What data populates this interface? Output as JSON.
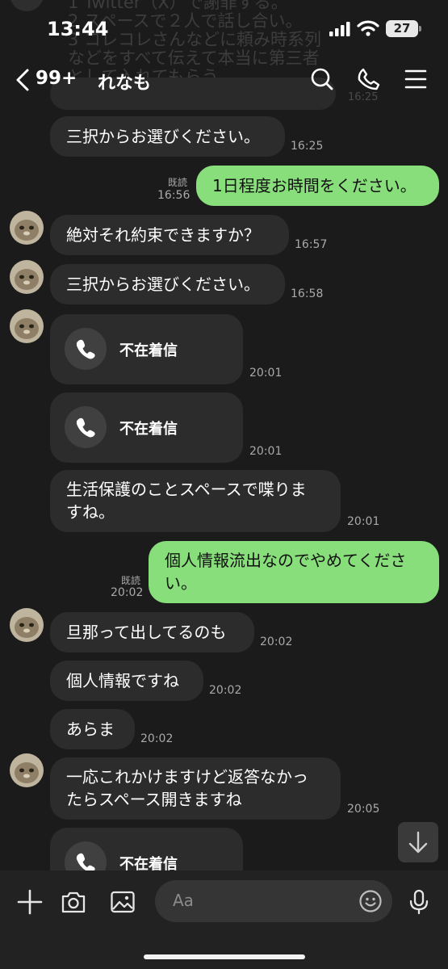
{
  "status_bar": {
    "time": "13:44",
    "battery": "27"
  },
  "ghost_text": [
    "1 Twitter（X）で謝罪する。",
    "2 スペースで２人で話し合い。",
    "3 コレコレさんなどに頼み時系列",
    "などをすべて伝えて本当に第三者",
    "として入れてもらう。"
  ],
  "ghost_time": "16:25",
  "header": {
    "unread_count": "99+",
    "contact_name": "れなも"
  },
  "messages": [
    {
      "text": "三択からお選びください。",
      "time": "16:25"
    },
    {
      "text": "1日程度お時間をください。",
      "read": "既読",
      "time": "16:56"
    },
    {
      "text": "絶対それ約束できますか？",
      "time": "16:57"
    },
    {
      "text": "三択からお選びください。",
      "time": "16:58"
    },
    {
      "text": "不在着信",
      "time": "20:01"
    },
    {
      "text": "不在着信",
      "time": "20:01"
    },
    {
      "lines": [
        "生活保護のことスペースで喋りま",
        "すね。"
      ],
      "time": "20:01"
    },
    {
      "lines": [
        "個人情報流出なのでやめてくださ",
        "い。"
      ],
      "read": "既読",
      "time": "20:02"
    },
    {
      "text": "旦那って出してるのも",
      "time": "20:02"
    },
    {
      "text": "個人情報ですね",
      "time": "20:02"
    },
    {
      "text": "あらま",
      "time": "20:02"
    },
    {
      "lines": [
        "一応これかけますけど返答なかっ",
        "たらスペース開きますね"
      ],
      "time": "20:05"
    },
    {
      "text": "不在着信"
    }
  ],
  "input_bar": {
    "placeholder": "Aa"
  },
  "icons": {
    "back": "chevron-left-icon",
    "search": "search-icon",
    "phone": "phone-icon",
    "menu": "menu-icon",
    "add": "plus-icon",
    "camera": "camera-icon",
    "image": "image-icon",
    "emoji": "emoji-icon",
    "mic": "mic-icon",
    "scroll": "arrow-down-icon"
  },
  "colors": {
    "background": "#1b1b1b",
    "incoming_bubble": "#2c2c2c",
    "outgoing_bubble": "#88de7b",
    "timestamp": "#a9a9a9"
  }
}
